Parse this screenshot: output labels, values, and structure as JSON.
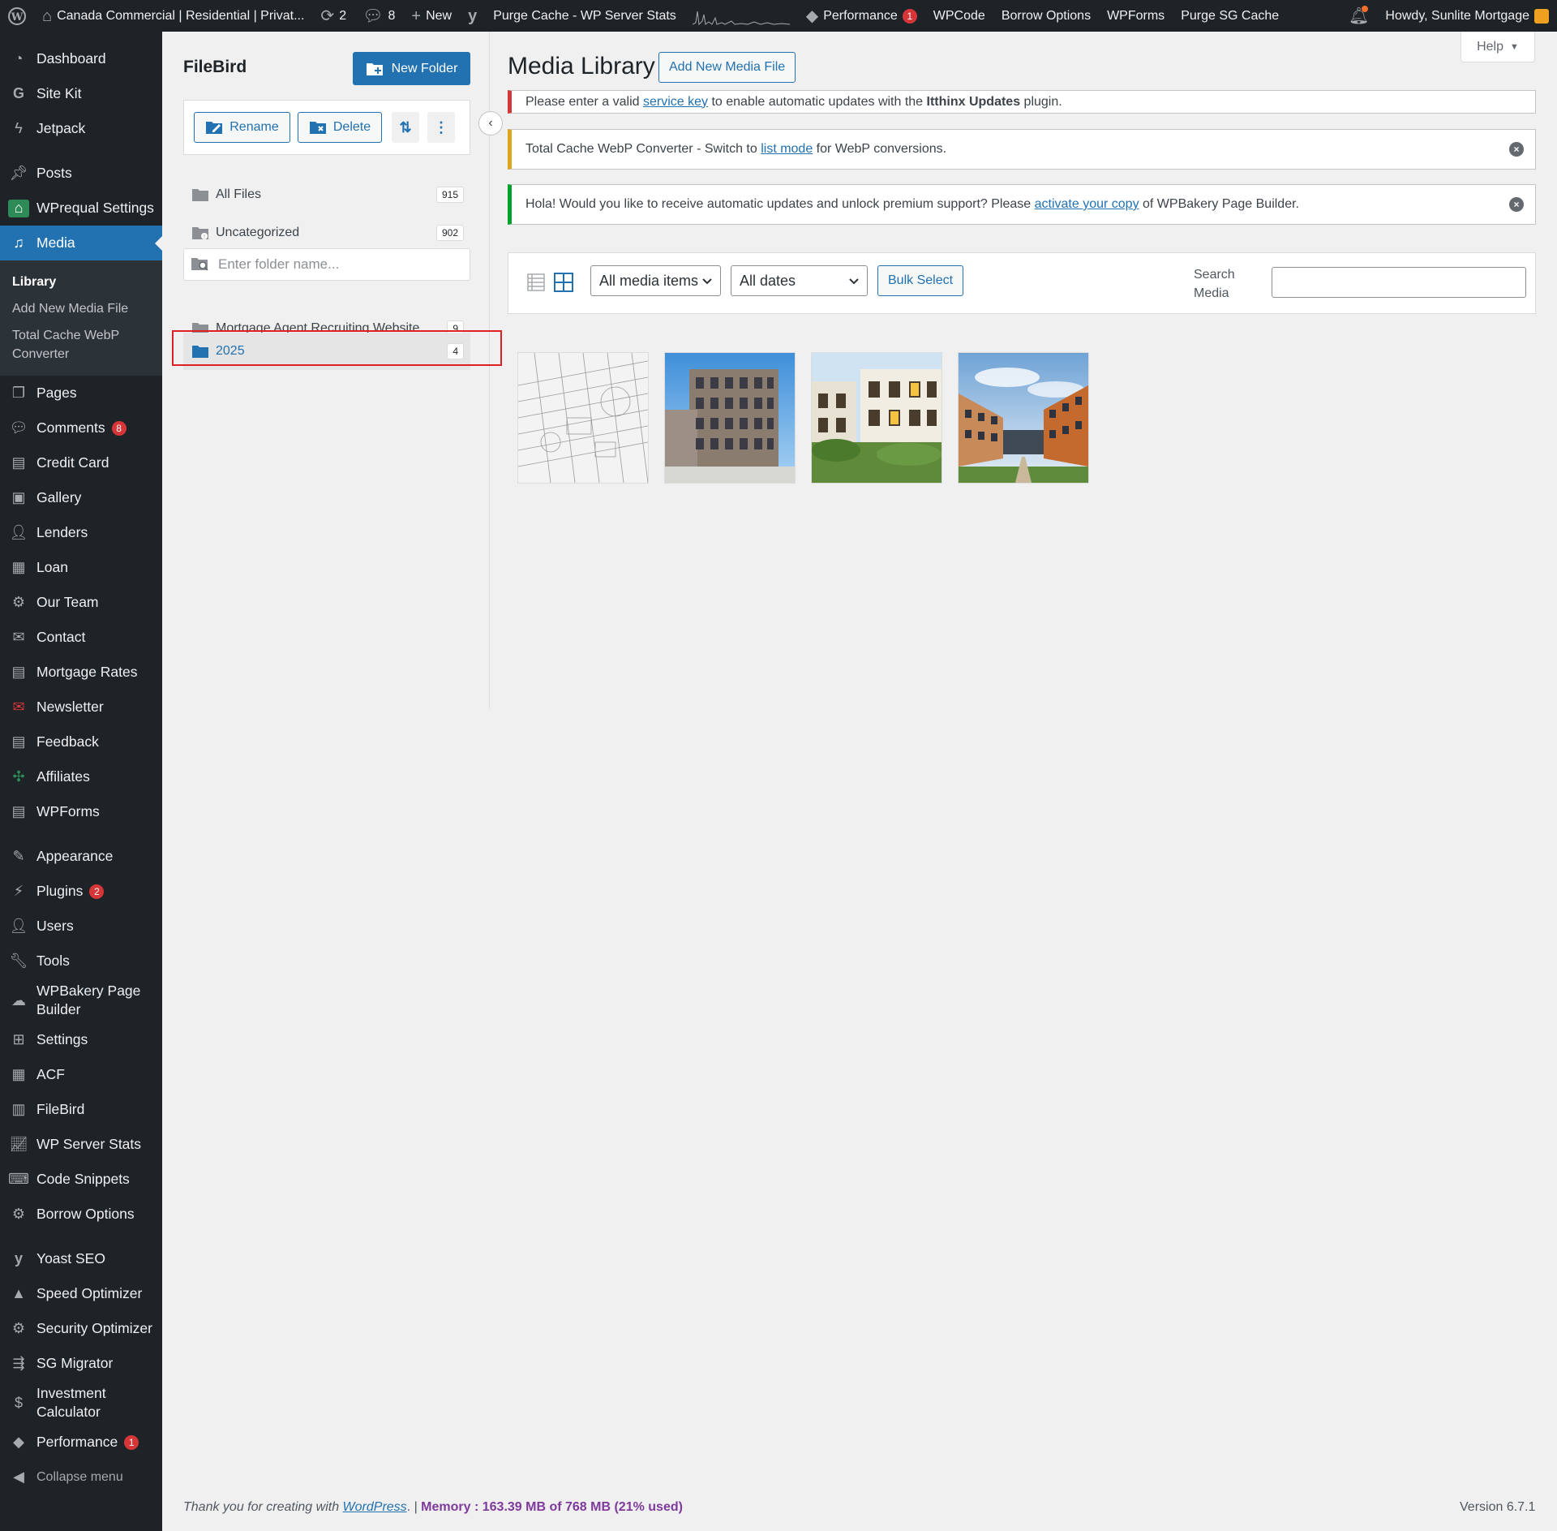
{
  "adminbar": {
    "site_title": "Canada Commercial | Residential | Privat...",
    "updates_count": "2",
    "comments_count": "8",
    "new_label": "New",
    "purge_cache_label": "Purge Cache - WP Server Stats",
    "performance_label": "Performance",
    "performance_badge": "1",
    "wpcode_label": "WPCode",
    "borrow_options_label": "Borrow Options",
    "wpforms_label": "WPForms",
    "purge_sg_label": "Purge SG Cache",
    "howdy_label": "Howdy, Sunlite Mortgage"
  },
  "sidebar": {
    "items": [
      {
        "label": "Dashboard",
        "icon": "dashboard-icon"
      },
      {
        "label": "Site Kit",
        "icon": "sitekit-icon"
      },
      {
        "label": "Jetpack",
        "icon": "jetpack-icon"
      },
      {
        "label": "Posts",
        "icon": "pin-icon"
      },
      {
        "label": "WPrequal Settings",
        "icon": "wprequal-icon"
      },
      {
        "label": "Media",
        "icon": "media-icon"
      },
      {
        "label": "Pages",
        "icon": "pages-icon"
      },
      {
        "label": "Comments",
        "icon": "comments-icon",
        "badge": "8"
      },
      {
        "label": "Credit Card",
        "icon": "creditcard-icon"
      },
      {
        "label": "Gallery",
        "icon": "gallery-icon"
      },
      {
        "label": "Lenders",
        "icon": "lenders-icon"
      },
      {
        "label": "Loan",
        "icon": "loan-icon"
      },
      {
        "label": "Our Team",
        "icon": "team-icon"
      },
      {
        "label": "Contact",
        "icon": "mail-icon"
      },
      {
        "label": "Mortgage Rates",
        "icon": "rates-icon"
      },
      {
        "label": "Newsletter",
        "icon": "newsletter-icon"
      },
      {
        "label": "Feedback",
        "icon": "feedback-icon"
      },
      {
        "label": "Affiliates",
        "icon": "affiliates-icon"
      },
      {
        "label": "WPForms",
        "icon": "wpforms-icon"
      },
      {
        "label": "Appearance",
        "icon": "appearance-icon"
      },
      {
        "label": "Plugins",
        "icon": "plugins-icon",
        "badge": "2"
      },
      {
        "label": "Users",
        "icon": "users-icon"
      },
      {
        "label": "Tools",
        "icon": "tools-icon"
      },
      {
        "label": "WPBakery Page Builder",
        "icon": "wpbakery-icon"
      },
      {
        "label": "Settings",
        "icon": "settings-icon"
      },
      {
        "label": "ACF",
        "icon": "acf-icon"
      },
      {
        "label": "FileBird",
        "icon": "filebird-icon"
      },
      {
        "label": "WP Server Stats",
        "icon": "chart-icon"
      },
      {
        "label": "Code Snippets",
        "icon": "code-icon"
      },
      {
        "label": "Borrow Options",
        "icon": "gear-icon"
      },
      {
        "label": "Yoast SEO",
        "icon": "yoast-icon"
      },
      {
        "label": "Speed Optimizer",
        "icon": "speed-icon"
      },
      {
        "label": "Security Optimizer",
        "icon": "security-icon"
      },
      {
        "label": "SG Migrator",
        "icon": "migrator-icon"
      },
      {
        "label": "Investment Calculator",
        "icon": "dollar-icon"
      },
      {
        "label": "Performance",
        "icon": "performance-icon",
        "badge": "1"
      },
      {
        "label": "Collapse menu",
        "icon": "collapse-icon"
      }
    ],
    "media_submenu": [
      {
        "label": "Library"
      },
      {
        "label": "Add New Media File"
      },
      {
        "label": "Total Cache WebP Converter"
      }
    ]
  },
  "filebird": {
    "title": "FileBird",
    "new_folder_label": "New Folder",
    "rename_label": "Rename",
    "delete_label": "Delete",
    "search_placeholder": "Enter folder name...",
    "all_files": {
      "label": "All Files",
      "count": "915"
    },
    "uncategorized": {
      "label": "Uncategorized",
      "count": "902"
    },
    "folders": [
      {
        "label": "Mortgage Agent Recruiting Website",
        "count": "9"
      },
      {
        "label": "2025",
        "count": "4"
      }
    ]
  },
  "main": {
    "help_label": "Help",
    "page_title": "Media Library",
    "add_new_label": "Add New Media File",
    "notices": [
      {
        "color": "#d63638",
        "before": "Please enter a valid ",
        "link": "service key",
        "middle": " to enable automatic updates with the ",
        "bold": "Itthinx Updates",
        "after": " plugin."
      },
      {
        "color": "#dba617",
        "before": "Total Cache WebP Converter - Switch to ",
        "link": "list mode",
        "after": " for WebP conversions."
      },
      {
        "color": "#00a32a",
        "before": "Hola! Would you like to receive automatic updates and unlock premium support? Please ",
        "link": "activate your copy",
        "after": " of WPBakery Page Builder."
      }
    ],
    "media_filter": "All media items",
    "date_filter": "All dates",
    "bulk_select_label": "Bulk Select",
    "search_label": "Search Media",
    "attachments": [
      {
        "alt": "architectural-plan-sketch"
      },
      {
        "alt": "modern-apartment-building"
      },
      {
        "alt": "residential-complex-garden"
      },
      {
        "alt": "apartment-courtyard-sky"
      }
    ]
  },
  "footer": {
    "thanks_text": "Thank you for creating with ",
    "wp_link": "WordPress",
    "separator": ". | ",
    "memory_text": "Memory : 163.39 MB of 768 MB (21% used)",
    "version": "Version 6.7.1"
  },
  "colors": {
    "admin_dark": "#1d2327",
    "accent": "#2271b1",
    "badge": "#d63638",
    "highlight": "#e02020"
  }
}
